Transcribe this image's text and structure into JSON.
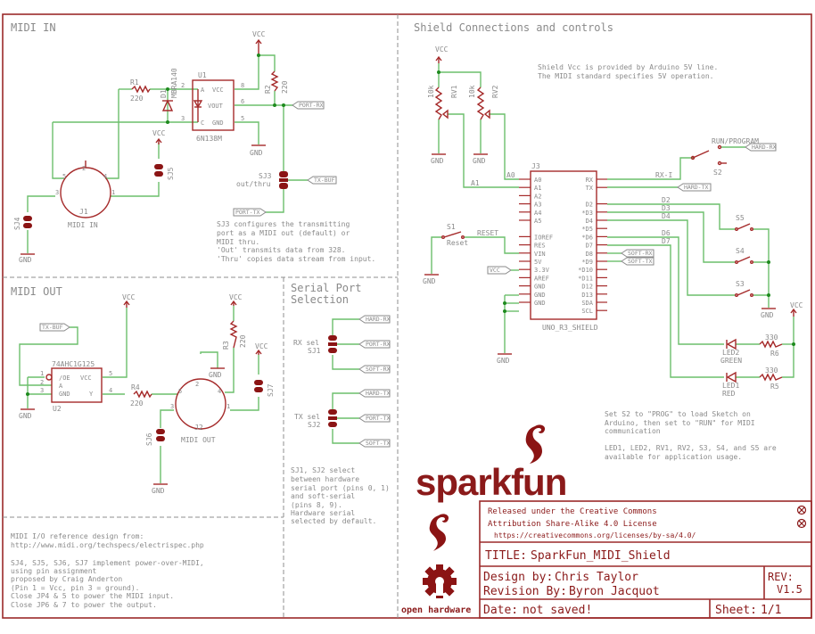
{
  "sections": {
    "midi_in": {
      "title": "MIDI IN",
      "vcc1": "VCC",
      "vcc2": "VCC",
      "gnd1": "GND",
      "gnd2": "GND",
      "r1_name": "R1",
      "r1_value": "220",
      "d1_name": "D1",
      "d1_value": "MBRA140",
      "u1_name": "U1",
      "u1_value": "6N138M",
      "u1_pins": [
        "A",
        "VCC",
        "VOUT",
        "C",
        "GND"
      ],
      "u1_pin_numbers": [
        "2",
        "8",
        "6",
        "3",
        "5"
      ],
      "r2_name": "R2",
      "r2_value": "220",
      "j1_name": "J1",
      "j1_value": "MIDI IN",
      "j1_pins": [
        "2",
        "5",
        "4",
        "3",
        "1"
      ],
      "sj4": "SJ4",
      "sj5": "SJ5",
      "sj3": "SJ3",
      "sj3_note": "out/thru",
      "port_rx": "PORT-RX",
      "tx_buf": "TX-BUF",
      "port_tx": "PORT-TX",
      "note": [
        "SJ3 configures the transmitting",
        "port as a MIDI out (default) or",
        "MIDI thru.",
        "'Out' transmits data from 328.",
        "'Thru' copies data stream from input."
      ]
    },
    "midi_out": {
      "title": "MIDI OUT",
      "vcc1": "VCC",
      "vcc2": "VCC",
      "vcc3": "VCC",
      "gnd1": "GND",
      "gnd2": "GND",
      "gnd3": "GND",
      "tx_buf": "TX-BUF",
      "u2_name": "U2",
      "u2_value": "74AHC1G125",
      "u2_pins": [
        "/OE",
        "A",
        "GND",
        "VCC",
        "Y"
      ],
      "u2_pin_numbers": [
        "1",
        "2",
        "3",
        "5",
        "4"
      ],
      "r4_name": "R4",
      "r4_value": "220",
      "r3_name": "R3",
      "r3_value": "220",
      "j2_name": "J2",
      "j2_value": "MIDI OUT",
      "j2_pins": [
        "2",
        "5",
        "4",
        "3",
        "1"
      ],
      "sj6": "SJ6",
      "sj7": "SJ7"
    },
    "serial": {
      "title_line1": "Serial Port",
      "title_line2": "Selection",
      "rx_sel": "RX sel",
      "sj1": "SJ1",
      "tx_sel": "TX sel",
      "sj2": "SJ2",
      "hard_rx": "HARD-RX",
      "port_rx": "PORT-RX",
      "soft_rx": "SOFT-RX",
      "hard_tx": "HARD-TX",
      "port_tx": "PORT-TX",
      "soft_tx": "SOFT-TX",
      "note": [
        "SJ1, SJ2 select",
        "between hardware",
        "serial port (pins 0, 1)",
        "and  soft-serial",
        "(pins 8, 9).",
        "Hardware serial",
        "selected by default."
      ]
    },
    "notes": {
      "lines": [
        "MIDI I/O reference design from:",
        "http://www.midi.org/techspecs/electrispec.php",
        "",
        "SJ4, SJ5, SJ6, SJ7 implement power-over-MIDI,",
        "using pin assignment",
        "proposed by Craig Anderton",
        "(Pin 1 = Vcc, pin 3 = ground).",
        "Close JP4 & 5 to power the MIDI input.",
        "Close JP6 & 7 to power the output."
      ]
    },
    "shield": {
      "title": "Shield Connections and controls",
      "vcc_note": [
        "Shield Vcc is provided by Arduino 5V line.",
        "The MIDI standard specifies 5V operation."
      ],
      "vcc1": "VCC",
      "vcc2": "VCC",
      "vcc_label": "VCC",
      "gnd1": "GND",
      "gnd2": "GND",
      "gnd3": "GND",
      "gnd4": "GND",
      "gnd5": "GND",
      "rv1_name": "RV1",
      "rv1_value": "10k",
      "rv2_name": "RV2",
      "rv2_value": "10k",
      "net_a0": "A0",
      "net_a1": "A1",
      "net_rx_i": "RX-I",
      "net_reset": "RESET",
      "s1_name": "S1",
      "s1_value": "Reset",
      "s2_name": "S2",
      "s2_value": "RUN/PROGRAM",
      "s3": "S3",
      "s4": "S4",
      "s5": "S5",
      "j3_name": "J3",
      "j3_value": "UNO_R3_SHIELD",
      "j3_left_pins": [
        "A0",
        "A1",
        "A2",
        "A3",
        "A4",
        "A5",
        "",
        "IOREF",
        "RES",
        "VIN",
        "5V",
        "3.3V",
        "AREF",
        "GND",
        "GND",
        "GND"
      ],
      "j3_right_pins": [
        "RX",
        "TX",
        "",
        "D2",
        "*D3",
        "D4",
        "*D5",
        "*D6",
        "D7",
        "D8",
        "*D9",
        "*D10",
        "*D11",
        "D12",
        "D13",
        "SDA",
        "SCL"
      ],
      "net_d2": "D2",
      "net_d3": "D3",
      "net_d4": "D4",
      "net_d6": "D6",
      "net_d7": "D7",
      "hard_rx": "HARD-RX",
      "hard_tx": "HARD-TX",
      "soft_rx": "SOFT-RX",
      "soft_tx": "SOFT-TX",
      "led2_name": "LED2",
      "led2_value": "GREEN",
      "led1_name": "LED1",
      "led1_value": "RED",
      "r6_name": "R6",
      "r6_value": "330",
      "r5_name": "R5",
      "r5_value": "330",
      "note1": [
        "Set S2 to \"PROG\" to load Sketch on",
        "Arduino, then set to \"RUN\" for MIDI",
        "communication"
      ],
      "note2": [
        "LED1, LED2, RV1, RV2, S3, S4, and S5 are",
        "available for application usage."
      ]
    }
  },
  "title_block": {
    "logo_text": "sparkfun",
    "oshw_text": "open hardware",
    "license_line1": "Released under the Creative Commons",
    "license_line2": "Attribution Share-Alike 4.0 License",
    "license_url": "https://creativecommons.org/licenses/by-sa/4.0/",
    "title_label": "TITLE:",
    "title_value": "SparkFun_MIDI_Shield",
    "design_label": "Design by:",
    "design_value": "Chris Taylor",
    "revision_label": "Revision By:",
    "revision_value": "Byron Jacquot",
    "rev_label": "REV:",
    "rev_value": "V1.5",
    "date_label": "Date:",
    "date_value": "not saved!",
    "sheet_label": "Sheet:",
    "sheet_value": "1/1"
  },
  "colors": {
    "frame": "#9b2a2a",
    "wire": "#6cbf6c",
    "part": "#a52a2a",
    "text": "#8a8a8a",
    "junction": "#1e8a1e"
  }
}
